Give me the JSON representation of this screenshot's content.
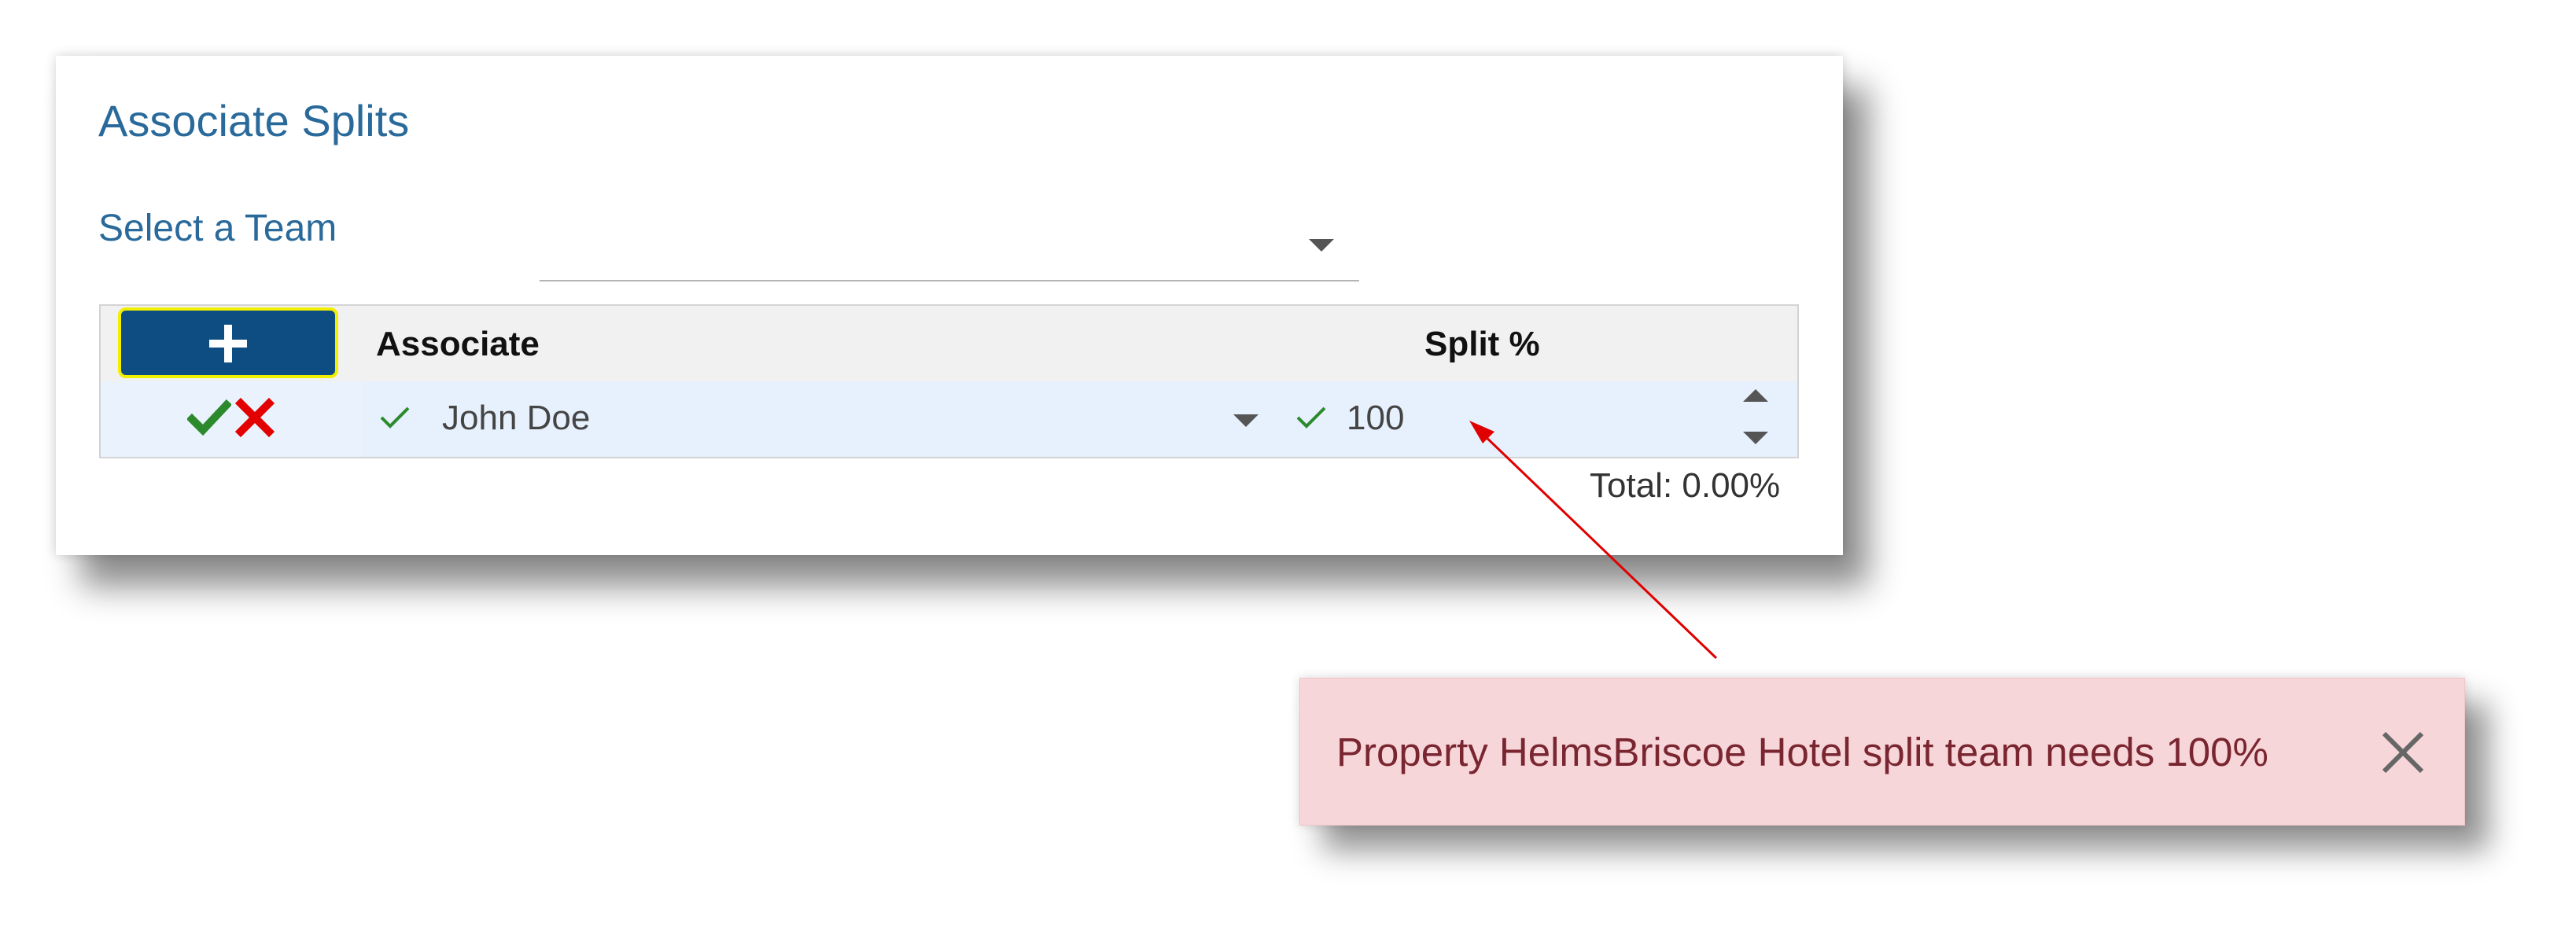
{
  "panel": {
    "title": "Associate Splits",
    "team_label": "Select a Team",
    "team_value": ""
  },
  "grid": {
    "add_button_icon": "plus-icon",
    "columns": {
      "associate": "Associate",
      "split": "Split %"
    },
    "rows": [
      {
        "associate": "John Doe",
        "split": "100",
        "actions": [
          "confirm-check-icon",
          "cancel-x-icon"
        ]
      }
    ],
    "total": "Total: 0.00%"
  },
  "toast": {
    "message": "Property HelmsBriscoe Hotel split team needs 100%",
    "close_icon": "close-icon"
  },
  "colors": {
    "title": "#2a6a9b",
    "add_button": "#0e4d82",
    "add_button_border": "#f2ef00",
    "confirm": "#2c8a2c",
    "cancel": "#e30000",
    "toast_bg": "#f7d6da",
    "toast_text": "#7a2630",
    "annotation_arrow": "#e00000"
  }
}
